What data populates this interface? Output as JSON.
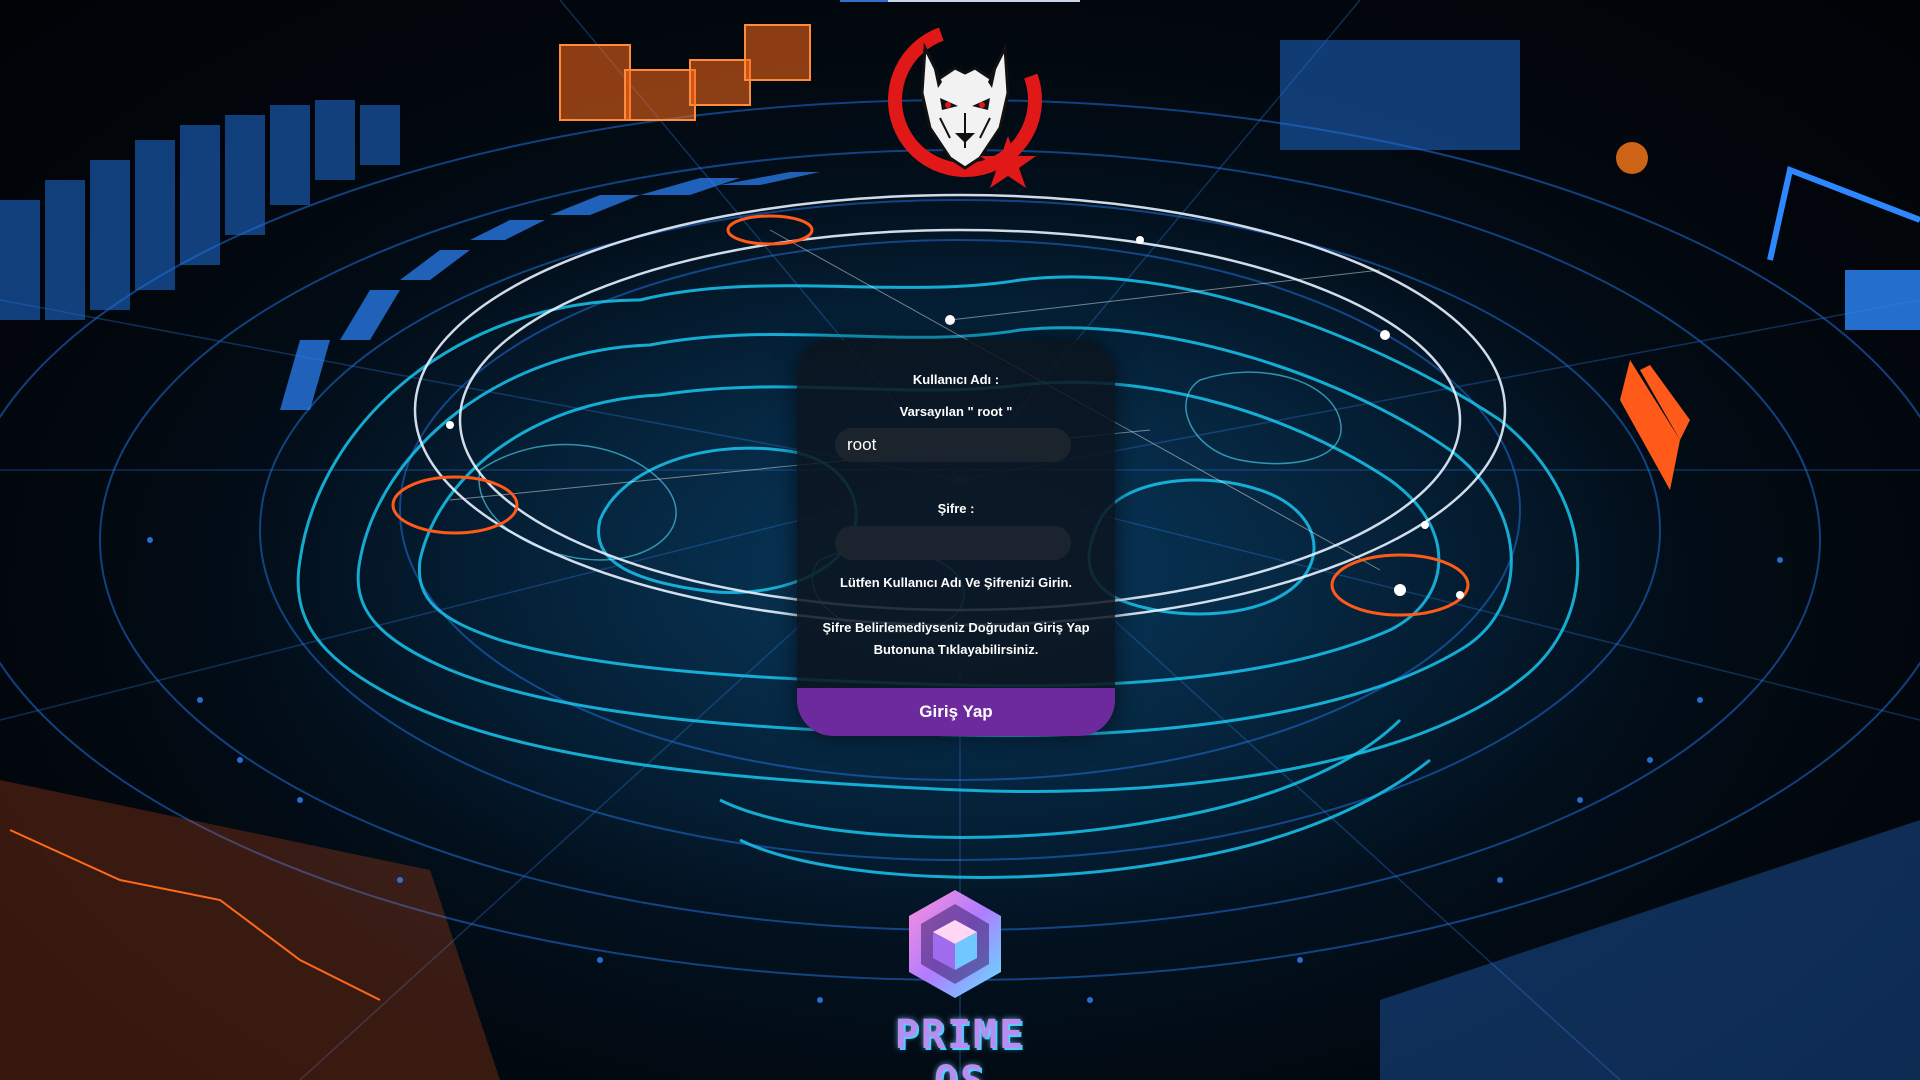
{
  "login": {
    "username_label": "Kullanıcı Adı :",
    "default_hint": "Varsayılan \" root \"",
    "username_value": "root",
    "password_label": "Şifre :",
    "password_value": "",
    "message_1": "Lütfen Kullanıcı Adı Ve Şifrenizi Girin.",
    "message_2": "Şifre Belirlemediyseniz Doğrudan Giriş Yap Butonuna Tıklayabilirsiniz.",
    "submit_label": "Giriş Yap"
  },
  "branding": {
    "os_name": "PRIME OS"
  },
  "colors": {
    "button": "#6d2a9c",
    "hud_cyan": "#19c6f0",
    "hud_blue": "#1f6fd8",
    "hud_orange": "#ff5a1a",
    "wolf_red": "#e01818"
  },
  "icons": {
    "brand_logo": "wolf-crescent-star-icon",
    "os_logo": "hexagon-cube-icon"
  }
}
